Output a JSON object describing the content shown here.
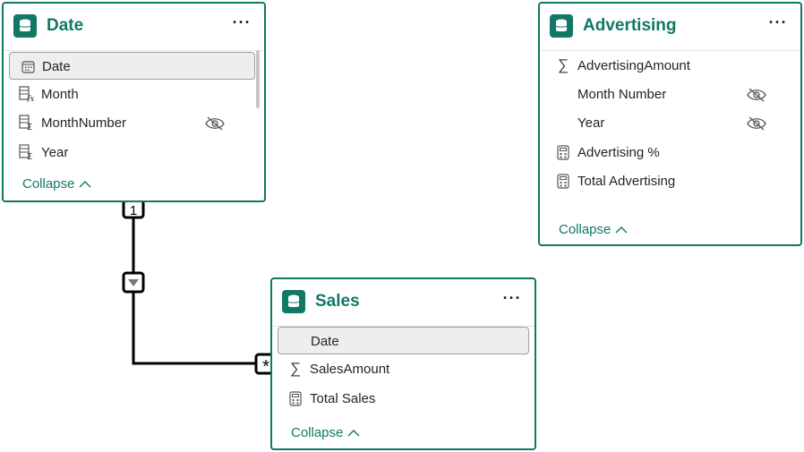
{
  "tables": {
    "date": {
      "title": "Date",
      "fields": [
        {
          "label": "Date",
          "icon": "calendar-icon",
          "selected": true
        },
        {
          "label": "Month",
          "icon": "calculated-column-icon"
        },
        {
          "label": "MonthNumber",
          "icon": "numeric-column-icon",
          "hidden": true
        },
        {
          "label": "Year",
          "icon": "numeric-column-icon"
        }
      ],
      "collapse_label": "Collapse"
    },
    "advertising": {
      "title": "Advertising",
      "fields": [
        {
          "label": "AdvertisingAmount",
          "icon": "sigma-icon"
        },
        {
          "label": "Month Number",
          "icon": "",
          "hidden": true
        },
        {
          "label": "Year",
          "icon": "",
          "hidden": true
        },
        {
          "label": "Advertising %",
          "icon": "calculator-icon"
        },
        {
          "label": "Total Advertising",
          "icon": "calculator-icon"
        }
      ],
      "collapse_label": "Collapse"
    },
    "sales": {
      "title": "Sales",
      "fields": [
        {
          "label": "Date",
          "icon": "",
          "selected": true
        },
        {
          "label": "SalesAmount",
          "icon": "sigma-icon"
        },
        {
          "label": "Total Sales",
          "icon": "calculator-icon"
        }
      ],
      "collapse_label": "Collapse"
    }
  },
  "relationship": {
    "from_cardinality": "1",
    "to_cardinality": "*",
    "filter_direction": "single"
  },
  "colors": {
    "accent": "#117865",
    "selected_bg": "#eeeeee",
    "text": "#252423"
  }
}
